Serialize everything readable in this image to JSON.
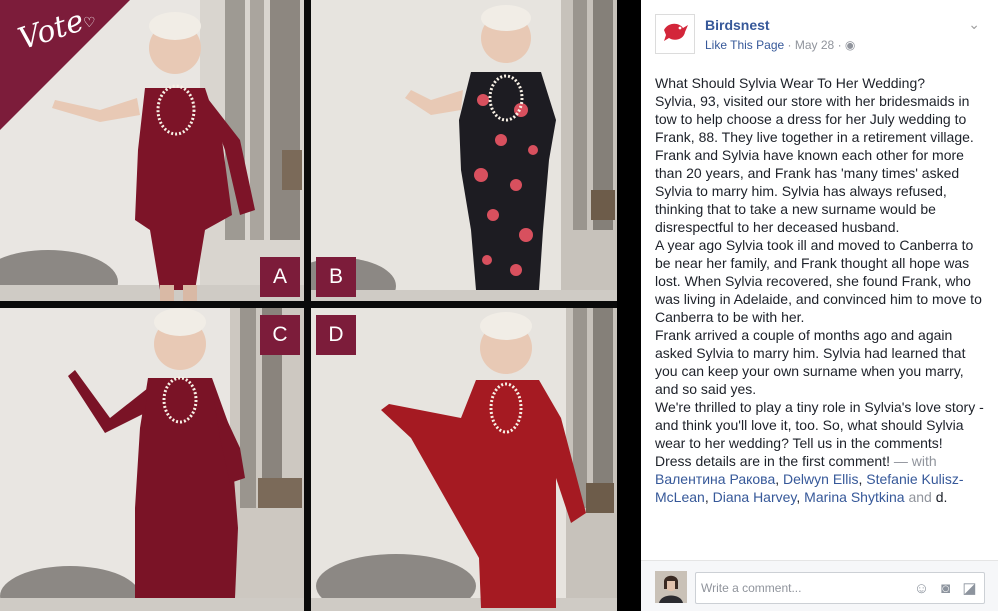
{
  "photo": {
    "vote_label": "Vote",
    "options": [
      {
        "letter": "A"
      },
      {
        "letter": "B"
      },
      {
        "letter": "C"
      },
      {
        "letter": "D"
      }
    ]
  },
  "post": {
    "page_name": "Birdsnest",
    "logo_text": "birdsnest",
    "like_label": "Like This Page",
    "separator": "·",
    "date": "May 28",
    "privacy_symbol": "·",
    "paragraphs": [
      "What Should Sylvia Wear To Her Wedding?",
      "Sylvia, 93, visited our store with her bridesmaids in tow to help choose a dress for her July wedding to Frank, 88. They live together in a retirement village. Frank and Sylvia have known each other for more than 20 years, and Frank has 'many times' asked Sylvia to marry him. Sylvia has always refused, thinking that to take a new surname would be disrespectful to her deceased husband.",
      "A year ago Sylvia took ill and moved to Canberra to be near her family, and Frank thought all hope was lost. When Sylvia recovered, she found Frank, who was living in Adelaide, and convinced him to move to Canberra to be with her.",
      "Frank arrived a couple of months ago and again asked Sylvia to marry him. Sylvia had learned that you can keep your own surname when you marry, and so said yes.",
      "We're thrilled to play a tiny role in Sylvia's love story - and think you'll love it, too. So, what should Sylvia wear to her wedding? Tell us in the comments!"
    ],
    "last_line": "Dress details are in the first comment!",
    "with_text": "— with",
    "tagged": [
      "Валентина Ракова",
      "Delwyn Ellis",
      "Stefanie Kulisz-McLean",
      "Diana Harvey",
      "Marina Shytkina"
    ],
    "and_text": "and",
    "more_text": "d."
  },
  "composer": {
    "placeholder": "Write a comment..."
  },
  "colors": {
    "brand_red": "#7c1c3a",
    "link": "#365899",
    "text": "#1d2129",
    "muted": "#90949c"
  },
  "icons": [
    "chevron-down-icon",
    "globe-icon",
    "emoji-icon",
    "camera-icon",
    "sticker-icon"
  ]
}
